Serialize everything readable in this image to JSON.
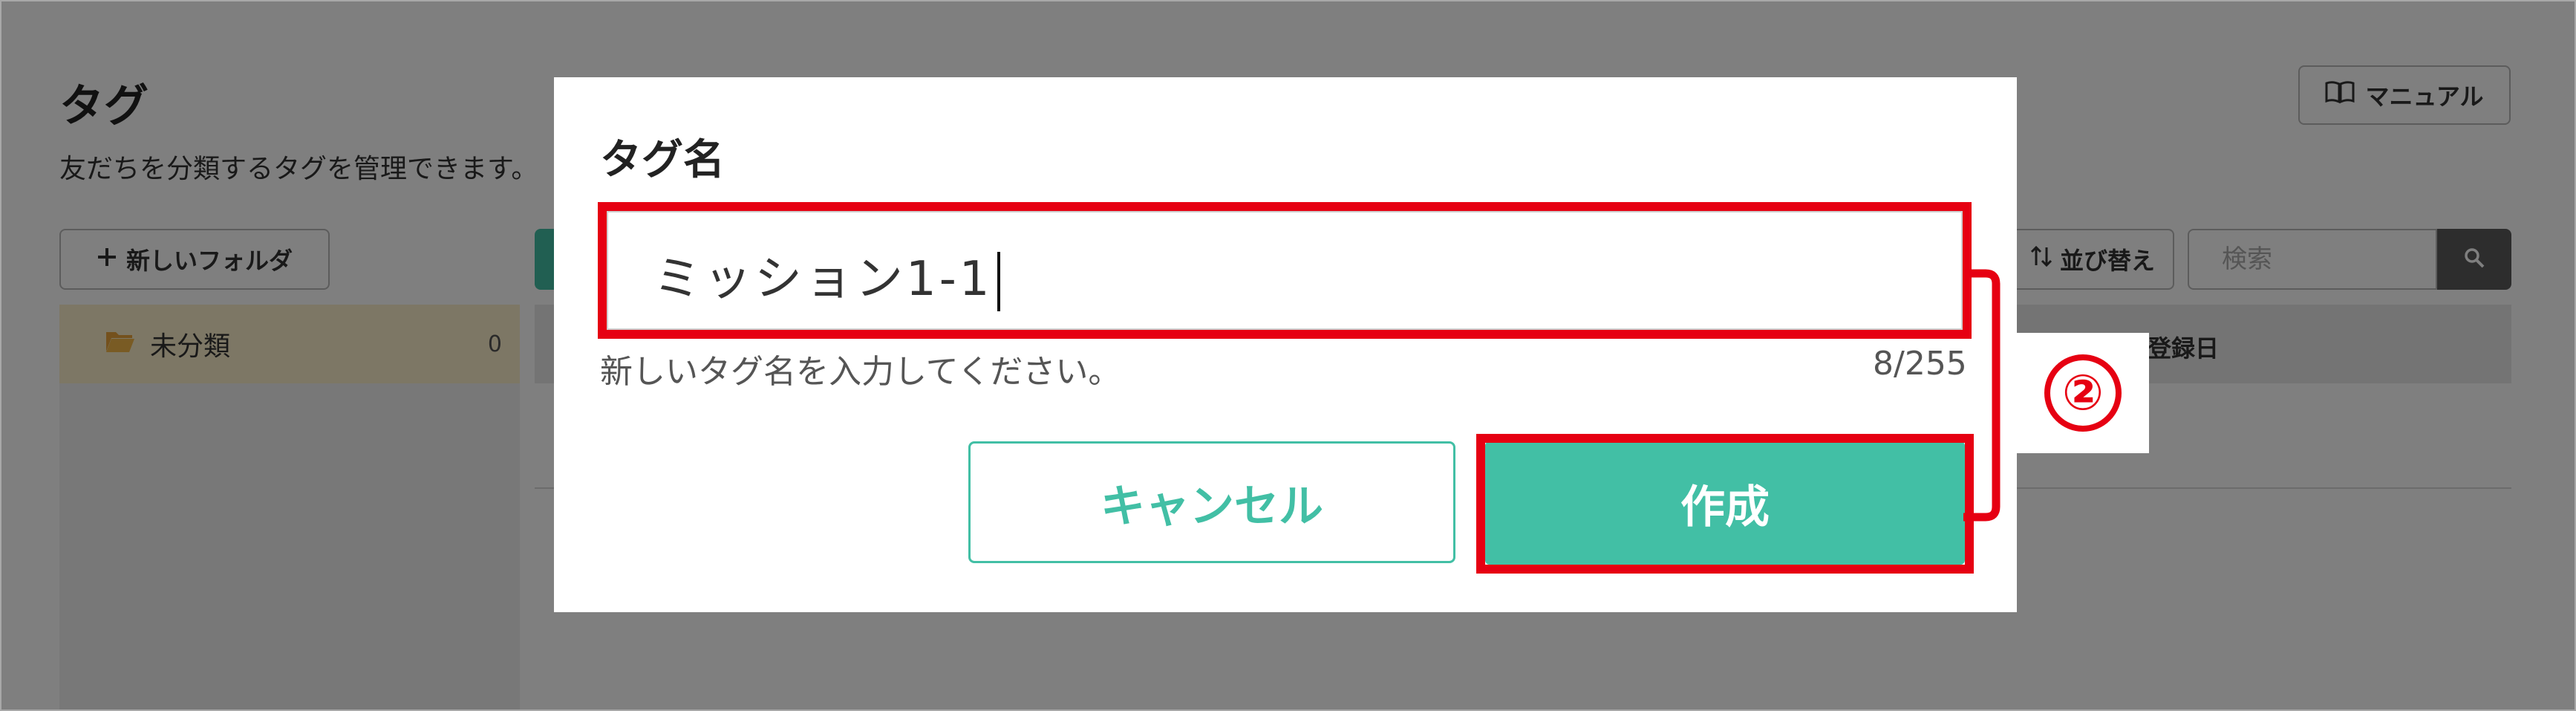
{
  "page": {
    "title": "タグ",
    "description": "友だちを分類するタグを管理できます。",
    "manual_label": "マニュアル",
    "new_folder_label": "新しいフォルダ",
    "folder": {
      "name": "未分類",
      "count": "0"
    },
    "sort_label": "並び替え",
    "search_placeholder": "検索",
    "column_date": "登録日"
  },
  "modal": {
    "title": "タグ名",
    "input_value": "ミッション1-1",
    "hint": "新しいタグ名を入力してください。",
    "counter": "8/255",
    "cancel_label": "キャンセル",
    "create_label": "作成"
  },
  "annotation": {
    "step_number": "②",
    "color": "#e60012"
  },
  "colors": {
    "accent": "#42bfa5",
    "overlay": "rgba(0,0,0,0.5)",
    "folder_highlight": "#fbeecb"
  },
  "icons": {
    "manual": "book-icon",
    "new_folder": "plus-icon",
    "folder": "folder-icon",
    "sort": "sort-arrows-icon",
    "search": "search-icon"
  }
}
